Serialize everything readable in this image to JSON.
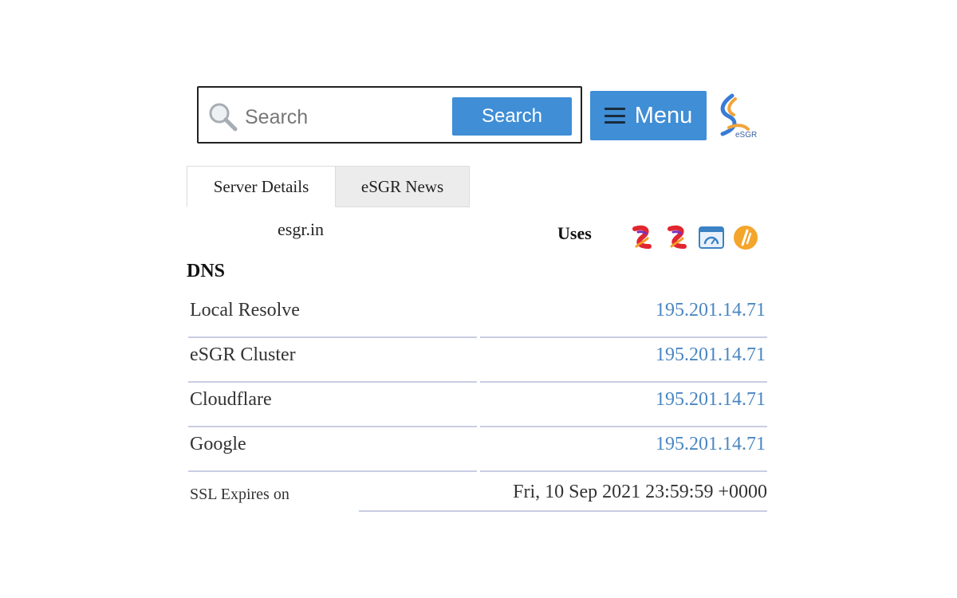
{
  "search": {
    "placeholder": "Search",
    "button_label": "Search",
    "icon": "magnifier-icon"
  },
  "menu": {
    "label": "Menu",
    "icon": "hamburger-icon"
  },
  "logo": {
    "text": "eSGR"
  },
  "tabs": [
    {
      "label": "Server Details",
      "active": true
    },
    {
      "label": "eSGR News",
      "active": false
    }
  ],
  "domain": "esgr.in",
  "uses": {
    "label": "Uses",
    "icons": [
      "red-ribbon-icon",
      "red-ribbon-icon",
      "browser-speed-icon",
      "orange-circle-icon"
    ]
  },
  "dns": {
    "heading": "DNS",
    "rows": [
      {
        "label": "Local Resolve",
        "value": "195.201.14.71"
      },
      {
        "label": "eSGR Cluster",
        "value": "195.201.14.71"
      },
      {
        "label": "Cloudflare",
        "value": "195.201.14.71"
      },
      {
        "label": "Google",
        "value": "195.201.14.71"
      }
    ]
  },
  "ssl": {
    "label": "SSL Expires on",
    "value": "Fri, 10 Sep 2021 23:59:59 +0000"
  },
  "colors": {
    "accent": "#3f8ed6",
    "link": "#4a86c2",
    "divider": "#c9cde3"
  }
}
